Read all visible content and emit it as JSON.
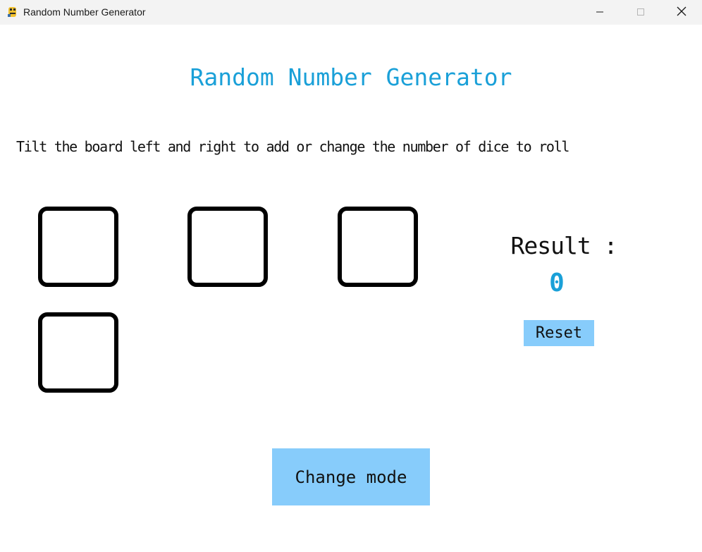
{
  "window": {
    "title": "Random Number Generator",
    "app_icon": "python-snake-icon",
    "controls": {
      "minimize_icon": "minimize-icon",
      "maximize_icon": "maximize-icon",
      "close_icon": "close-icon"
    }
  },
  "main": {
    "heading": "Random Number Generator",
    "instructions": "Tilt the board left and right to add or change the number of dice to roll",
    "dice_count": 4,
    "result": {
      "label": "Result :",
      "value": "0"
    },
    "reset_label": "Reset",
    "change_mode_label": "Change mode"
  },
  "colors": {
    "accent": "#1aa0d8",
    "button_bg": "#87ccfb",
    "titlebar_bg": "#f3f3f3",
    "die_border": "#000000"
  }
}
